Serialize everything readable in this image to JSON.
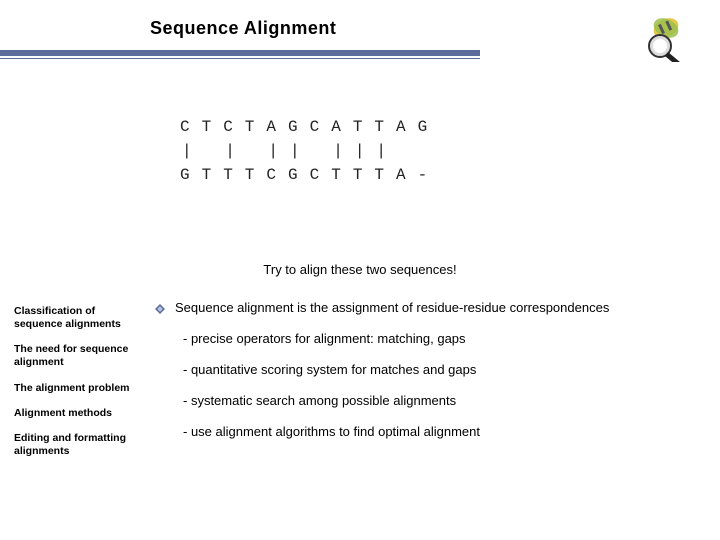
{
  "title": "Sequence Alignment",
  "logo_name": "dna-magnifier-logo",
  "figure": {
    "seq1": "CTCTAGCATTAG",
    "bars": "|  |  ||  |||",
    "seq2": "GTTTCGCTTTA-"
  },
  "caption": "Try to align these two sequences!",
  "sidebar": {
    "items": [
      "Classification of sequence alignments",
      "The need for sequence alignment",
      "The alignment problem",
      "Alignment methods",
      "Editing and formatting alignments"
    ]
  },
  "main": {
    "bullet": "Sequence alignment is the assignment of residue-residue correspondences",
    "sub": [
      "- precise operators for alignment: matching, gaps",
      "- quantitative scoring system for matches and gaps",
      "- systematic search among possible alignments",
      "- use alignment algorithms to find optimal alignment"
    ]
  },
  "colors": {
    "accent": "#5a6b9c"
  }
}
